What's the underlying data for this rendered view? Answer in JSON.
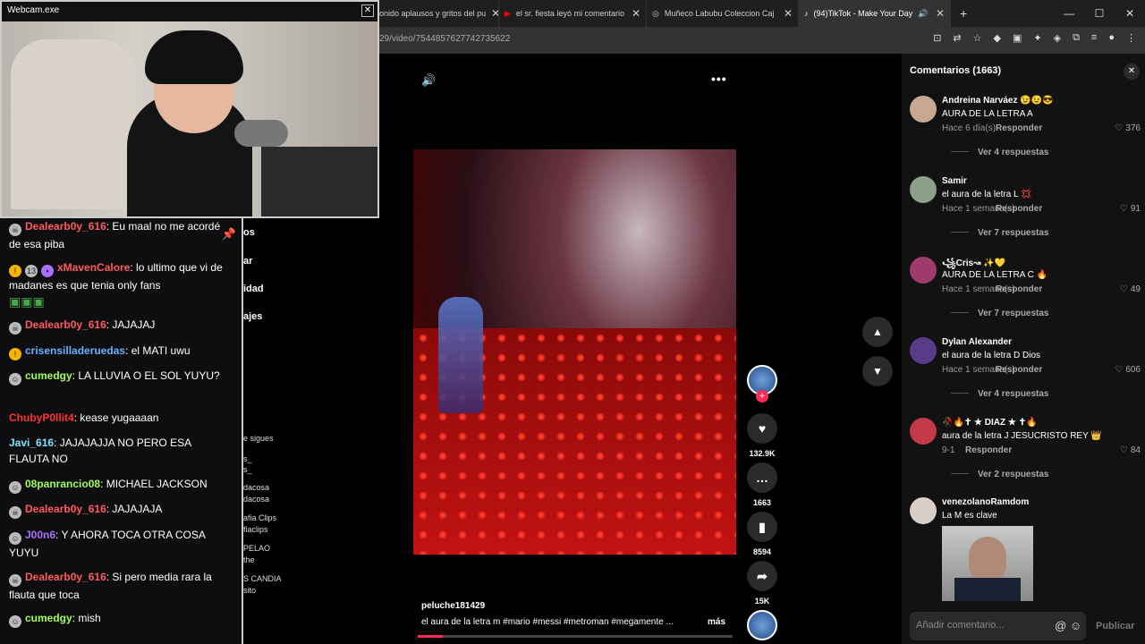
{
  "tabs": [
    {
      "label": "onido aplausos y gritos del pu"
    },
    {
      "label": "el sr. fiesta leyó mi comentario"
    },
    {
      "label": "Muñeco Labubu Coleccion Caj"
    },
    {
      "label": "(94)TikTok - Make Your Day"
    }
  ],
  "browser": {
    "url": "29/video/7544857627742735622",
    "new_tab": "+",
    "minimize": "—",
    "maximize": "☐",
    "close": "✕"
  },
  "webcam": {
    "title": "Webcam.exe",
    "close": "✕"
  },
  "chat": [
    {
      "user": "Dealearb0y_616",
      "color": "#ff5a5a",
      "text": "Eu maal no me acordé de esa piba"
    },
    {
      "user": "xMavenCalore",
      "color": "#ff5a5a",
      "text": "lo ultimo que vi de madanes es que tenia only fans"
    },
    {
      "user": "Dealearb0y_616",
      "color": "#ff5a5a",
      "text": "JAJAJAJ"
    },
    {
      "user": "crisensilladeruedas",
      "color": "#6ab0ff",
      "text": "el MATI uwu"
    },
    {
      "user": "cumedgy",
      "color": "#9dff5a",
      "text": "LA LLUVIA O EL SOL YUYU?"
    },
    {
      "user": "ChubyP0llit4",
      "color": "#ff3030",
      "text": "kease yugaaaan"
    },
    {
      "user": "Javi_616",
      "color": "#7fe0ff",
      "text": "JAJAJAJJA NO PERO ESA FLAUTA NO"
    },
    {
      "user": "08panrancio08",
      "color": "#9dff5a",
      "text": "MICHAEL JACKSON"
    },
    {
      "user": "Dealearb0y_616",
      "color": "#ff5a5a",
      "text": "JAJAJAJA"
    },
    {
      "user": "J00n6",
      "color": "#a970ff",
      "text": "Y AHORA TOCA OTRA COSA YUYU"
    },
    {
      "user": "Dealearb0y_616",
      "color": "#ff5a5a",
      "text": "Si pero media rara la flauta que toca"
    },
    {
      "user": "cumedgy",
      "color": "#9dff5a",
      "text": "mish"
    }
  ],
  "leftnav": {
    "items": [
      "os",
      "ar",
      "idad",
      "ajes"
    ],
    "following_label": "e sigues",
    "accounts": [
      "s_",
      "s_",
      "dacosa",
      "dacosa",
      "afia Clips",
      "fiaclips",
      "PELAO",
      "the",
      "S CANDIA",
      "sito"
    ]
  },
  "video": {
    "author": "peluche181429",
    "caption": "el aura de la letra m #mario #messi #metroman #megamente ...",
    "more": "más",
    "likes": "132.9K",
    "comments": "1663",
    "saves": "8594",
    "shares": "15K",
    "progress_percent": 8
  },
  "comments_panel": {
    "title": "Comentarios (1663)",
    "input_placeholder": "Añadir comentario...",
    "publish": "Publicar",
    "items": [
      {
        "name": "Andreina Narváez 😉😉😎",
        "text": "AURA DE LA LETRA A",
        "meta": "Hace 6 día(s)",
        "reply": "Responder",
        "likes": "376",
        "more": "Ver 4 respuestas"
      },
      {
        "name": "Samir",
        "text": "el aura de la letra L 💢",
        "meta": "Hace 1 semana(s)",
        "reply": "Responder",
        "likes": "91",
        "more": "Ver 7 respuestas"
      },
      {
        "name": "꧁Cris↝ ✨💛",
        "text": "AURA DE LA LETRA C 🔥",
        "meta": "Hace 1 semana(s)",
        "reply": "Responder",
        "likes": "49",
        "more": "Ver 7 respuestas"
      },
      {
        "name": "Dylan Alexander",
        "text": "el aura de la letra D Dios",
        "meta": "Hace 1 semana(s)",
        "reply": "Responder",
        "likes": "606",
        "more": "Ver 4 respuestas"
      },
      {
        "name": "🥀🔥✝ ★ DIAZ ★ ✝🔥",
        "text": "aura de la letra J JESUCRISTO REY 👑",
        "meta": "9-1",
        "reply": "Responder",
        "likes": "84",
        "more": "Ver 2 respuestas"
      },
      {
        "name": "venezolanoRamdom",
        "text": "La M es clave",
        "meta": "",
        "reply": "",
        "likes": "",
        "more": ""
      }
    ]
  },
  "colors": {
    "accent": "#fe2c55",
    "panel": "#121212"
  }
}
